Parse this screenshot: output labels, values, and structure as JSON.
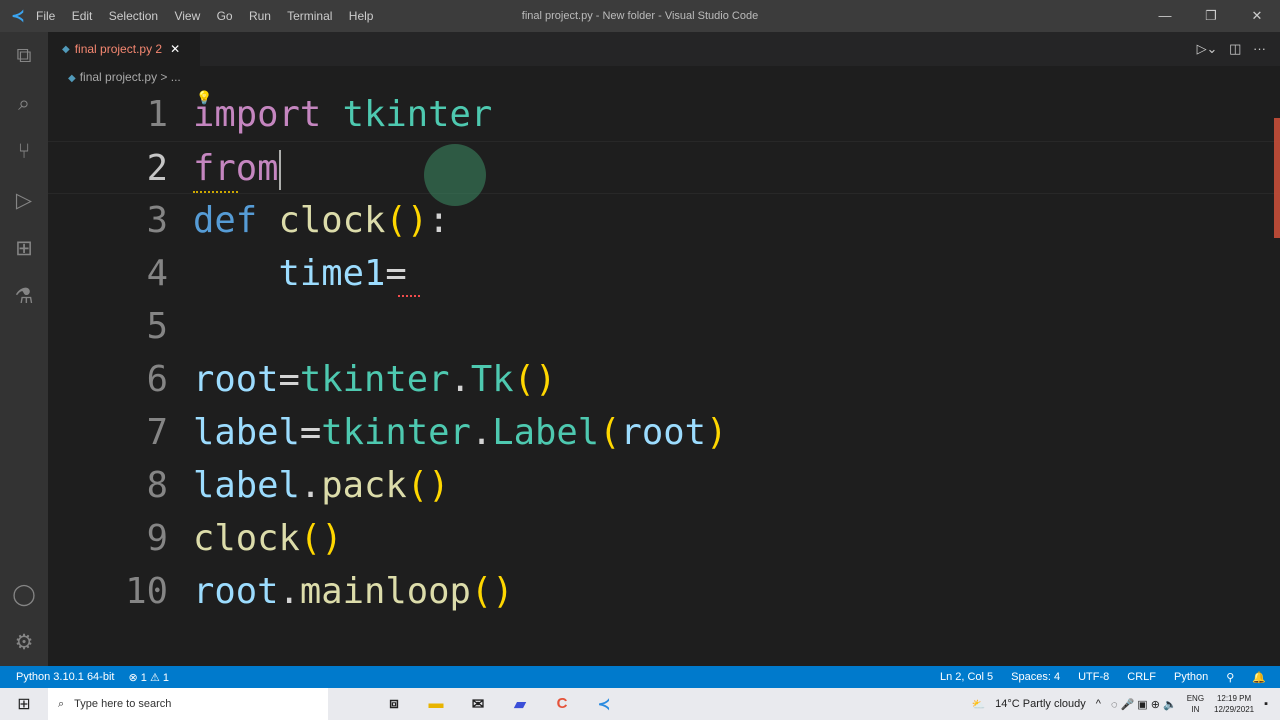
{
  "titlebar": {
    "menu": [
      "File",
      "Edit",
      "Selection",
      "View",
      "Go",
      "Run",
      "Terminal",
      "Help"
    ],
    "title": "final project.py - New folder - Visual Studio Code"
  },
  "tab": {
    "label": "final project.py",
    "problems": "2"
  },
  "breadcrumb": {
    "file": "final project.py",
    "sep": " > ",
    "rest": "..."
  },
  "code": [
    {
      "n": "1",
      "tokens": [
        [
          "kw",
          "import"
        ],
        [
          "pun",
          " "
        ],
        [
          "mod",
          "tkinter"
        ]
      ]
    },
    {
      "n": "2",
      "tokens": [
        [
          "kw",
          "from"
        ]
      ],
      "current": true
    },
    {
      "n": "3",
      "tokens": [
        [
          "def",
          "def"
        ],
        [
          "pun",
          " "
        ],
        [
          "fn",
          "clock"
        ],
        [
          "br",
          "()"
        ],
        [
          "pun",
          ":"
        ]
      ]
    },
    {
      "n": "4",
      "tokens": [
        [
          "pun",
          "    "
        ],
        [
          "var",
          "time1"
        ],
        [
          "pun",
          "="
        ]
      ]
    },
    {
      "n": "5",
      "tokens": []
    },
    {
      "n": "6",
      "tokens": [
        [
          "var",
          "root"
        ],
        [
          "pun",
          "="
        ],
        [
          "mod",
          "tkinter"
        ],
        [
          "pun",
          "."
        ],
        [
          "mod",
          "Tk"
        ],
        [
          "br",
          "()"
        ]
      ]
    },
    {
      "n": "7",
      "tokens": [
        [
          "var",
          "label"
        ],
        [
          "pun",
          "="
        ],
        [
          "mod",
          "tkinter"
        ],
        [
          "pun",
          "."
        ],
        [
          "mod",
          "Label"
        ],
        [
          "br",
          "("
        ],
        [
          "var",
          "root"
        ],
        [
          "br",
          ")"
        ]
      ]
    },
    {
      "n": "8",
      "tokens": [
        [
          "var",
          "label"
        ],
        [
          "pun",
          "."
        ],
        [
          "fn",
          "pack"
        ],
        [
          "br",
          "()"
        ]
      ]
    },
    {
      "n": "9",
      "tokens": [
        [
          "fn",
          "clock"
        ],
        [
          "br",
          "()"
        ]
      ]
    },
    {
      "n": "10",
      "tokens": [
        [
          "var",
          "root"
        ],
        [
          "pun",
          "."
        ],
        [
          "fn",
          "mainloop"
        ],
        [
          "br",
          "()"
        ]
      ]
    }
  ],
  "statusbar": {
    "interpreter": "Python 3.10.1 64-bit",
    "errors": "1",
    "warnings": "1",
    "position": "Ln 2, Col 5",
    "spaces": "Spaces: 4",
    "encoding": "UTF-8",
    "eol": "CRLF",
    "language": "Python"
  },
  "taskbar": {
    "search_placeholder": "Type here to search",
    "weather": "14°C  Partly cloudy",
    "lang1": "ENG",
    "lang2": "IN",
    "time": "12:19 PM",
    "date": "12/29/2021"
  }
}
